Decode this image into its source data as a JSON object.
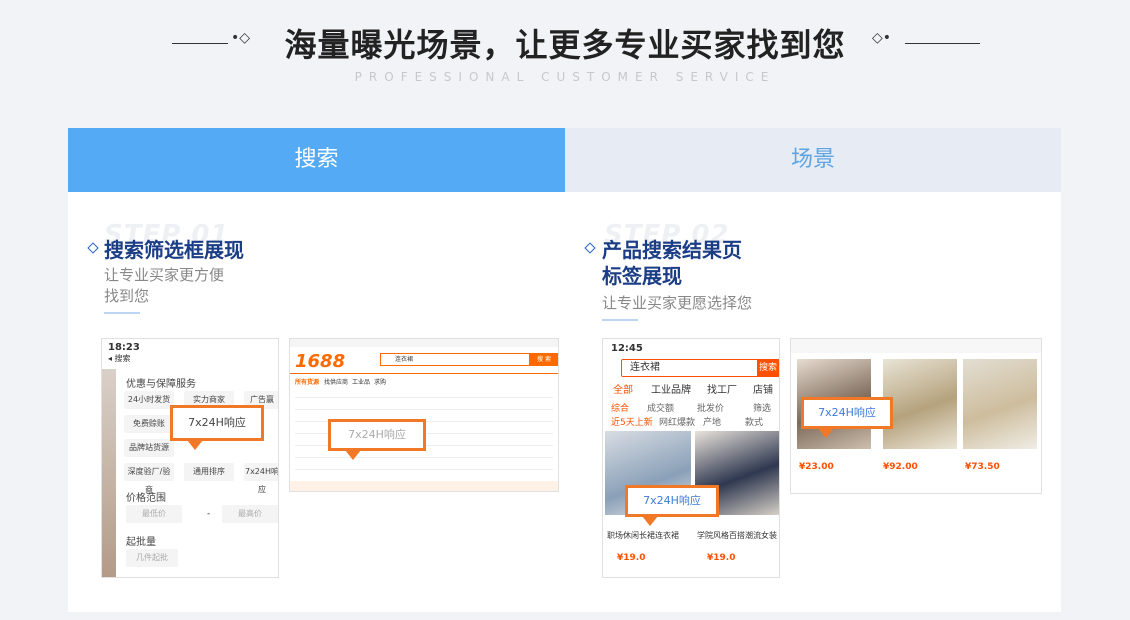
{
  "header": {
    "title": "海量曝光场景，让更多专业买家找到您",
    "subtitle": "PROFESSIONAL CUSTOMER SERVICE",
    "deco_left": "•◇",
    "deco_right": "◇•"
  },
  "tabs": [
    {
      "label": "搜索"
    },
    {
      "label": "场景"
    }
  ],
  "steps": [
    {
      "bg": "STEP 01",
      "title": "搜索筛选框展现",
      "desc_line1": "让专业买家更方便",
      "desc_line2": "找到您"
    },
    {
      "bg": "STEP 02",
      "title_line1": "产品搜索结果页",
      "title_line2": "标签展现",
      "desc": "让专业买家更愿选择您"
    }
  ],
  "badge": "7x24H响应",
  "phone1": {
    "time": "18:23",
    "back": "◂ 搜索",
    "section1": "优惠与保障服务",
    "chips": [
      "24小时发货",
      "实力商家",
      "广告赢",
      "免费赊账",
      "品牌站货源",
      "深度验厂/验商",
      "通用排序",
      "7x24H响应"
    ],
    "section2": "价格范围",
    "min_price": "最低价",
    "dash": "-",
    "max_price": "最高价",
    "section3": "起批量",
    "qty": "几件起批"
  },
  "pc": {
    "logo": "1688",
    "search_text": "连衣裙",
    "search_btn": "搜 索",
    "nav": [
      "所有货源",
      "找供应商",
      "工业品",
      "求购"
    ]
  },
  "phone2": {
    "time": "12:45",
    "search_text": "连衣裙",
    "search_btn": "搜索",
    "tabs": [
      "全部",
      "工业品牌",
      "找工厂",
      "店铺"
    ],
    "filters": [
      "综合",
      "成交额",
      "批发价",
      "筛选"
    ],
    "filters2": [
      "近5天上新",
      "网红爆款",
      "产地",
      "款式"
    ],
    "cap1": "职场休闲长裙连衣裙",
    "cap2": "学院风格百搭潮流女装",
    "price1": "¥19.0",
    "price2": "¥19.0"
  },
  "grid": {
    "prices": [
      "¥23.00",
      "¥92.00",
      "¥73.50"
    ]
  }
}
